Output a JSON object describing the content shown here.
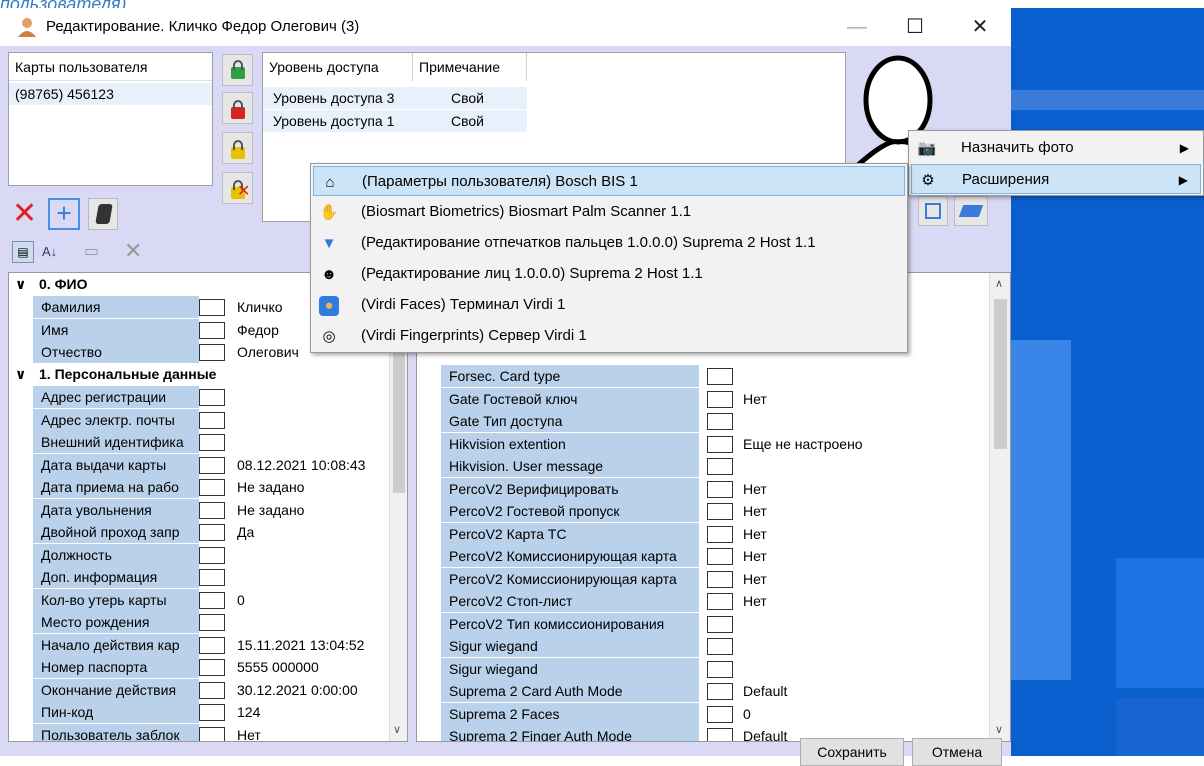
{
  "doc_link": "пользователя).",
  "window": {
    "title": "Редактирование. Кличко Федор Олегович (3)",
    "minimize": "—",
    "maximize": "☐",
    "close": "✕"
  },
  "cards": {
    "header": "Карты пользователя",
    "items": [
      "(98765) 456123"
    ]
  },
  "access": {
    "col_level": "Уровень доступа",
    "col_note": "Примечание",
    "rows": [
      {
        "level": "Уровень доступа 3",
        "note": "Свой"
      },
      {
        "level": "Уровень доступа 1",
        "note": "Свой"
      }
    ]
  },
  "left_grid": {
    "categories": [
      {
        "label": "0. ФИО",
        "toggle": "∨"
      },
      {
        "label": "1. Персональные данные",
        "toggle": "∨"
      }
    ],
    "fio_rows": [
      {
        "label": "Фамилия",
        "value": "Кличко"
      },
      {
        "label": "Имя",
        "value": "Федор"
      },
      {
        "label": "Отчество",
        "value": "Олегович"
      }
    ],
    "personal_rows": [
      {
        "label": "Адрес регистрации",
        "value": ""
      },
      {
        "label": "Адрес электр. почты",
        "value": ""
      },
      {
        "label": "Внешний идентифика",
        "value": ""
      },
      {
        "label": "Дата выдачи карты",
        "value": "08.12.2021 10:08:43"
      },
      {
        "label": "Дата приема на рабо",
        "value": "Не задано"
      },
      {
        "label": "Дата увольнения",
        "value": "Не задано"
      },
      {
        "label": "Двойной проход запр",
        "value": "Да"
      },
      {
        "label": "Должность",
        "value": ""
      },
      {
        "label": "Доп. информация",
        "value": ""
      },
      {
        "label": "Кол-во утерь карты",
        "value": "0"
      },
      {
        "label": "Место рождения",
        "value": ""
      },
      {
        "label": "Начало действия кар",
        "value": "15.11.2021 13:04:52"
      },
      {
        "label": "Номер паспорта",
        "value": "5555 000000"
      },
      {
        "label": "Окончание действия",
        "value": "30.12.2021 0:00:00"
      },
      {
        "label": "Пин-код",
        "value": "124"
      },
      {
        "label": "Пользователь заблок",
        "value": "Нет"
      }
    ]
  },
  "right_grid": {
    "rows": [
      {
        "label": "Forsec. Card type",
        "value": ""
      },
      {
        "label": "Gate Гостевой ключ",
        "value": "Нет"
      },
      {
        "label": "Gate Тип доступа",
        "value": ""
      },
      {
        "label": "Hikvision extention",
        "value": "Еще не настроено"
      },
      {
        "label": "Hikvision. User message",
        "value": ""
      },
      {
        "label": "PercoV2 Верифицировать",
        "value": "Нет"
      },
      {
        "label": "PercoV2 Гостевой пропуск",
        "value": "Нет"
      },
      {
        "label": "PercoV2 Карта ТС",
        "value": "Нет"
      },
      {
        "label": "PercoV2 Комиссионирующая карта",
        "value": "Нет"
      },
      {
        "label": "PercoV2 Комиссионирующая карта",
        "value": "Нет"
      },
      {
        "label": "PercoV2 Стоп-лист",
        "value": "Нет"
      },
      {
        "label": "PercoV2 Тип комиссионирования",
        "value": ""
      },
      {
        "label": "Sigur wiegand",
        "value": ""
      },
      {
        "label": "Sigur wiegand",
        "value": ""
      },
      {
        "label": "Suprema 2 Card Auth Mode",
        "value": "Default"
      },
      {
        "label": "Suprema 2 Faces",
        "value": "0"
      },
      {
        "label": "Suprema 2 Finger Auth Mode",
        "value": "Default"
      }
    ]
  },
  "context_menu": {
    "items": [
      {
        "label": "Назначить фото",
        "arrow": "▶",
        "icon": "camera-icon"
      },
      {
        "label": "Расширения",
        "arrow": "▶",
        "icon": "gear-icon"
      }
    ]
  },
  "submenu": {
    "items": [
      {
        "label": "(Параметры пользователя) Bosch BIS 1",
        "icon": "scanner-icon"
      },
      {
        "label": "(Biosmart Biometrics) Biosmart Palm Scanner 1.1",
        "icon": "palm-icon"
      },
      {
        "label": "(Редактирование отпечатков пальцев 1.0.0.0) Suprema 2 Host 1.1",
        "icon": "fingerprint-edit-icon"
      },
      {
        "label": "(Редактирование лиц 1.0.0.0) Suprema 2 Host 1.1",
        "icon": "face-edit-icon"
      },
      {
        "label": "(Virdi Faces) Терминал Virdi 1",
        "icon": "face-icon"
      },
      {
        "label": "(Virdi Fingerprints) Сервер Virdi 1",
        "icon": "fingerprint-icon"
      }
    ]
  },
  "buttons": {
    "save": "Сохранить",
    "cancel": "Отмена"
  },
  "colors": {
    "body_bg": "#d9d9f5",
    "grid_label_bg": "#b9d1ea",
    "highlight": "#cce4f7",
    "desktop": "#0a5fcf"
  }
}
